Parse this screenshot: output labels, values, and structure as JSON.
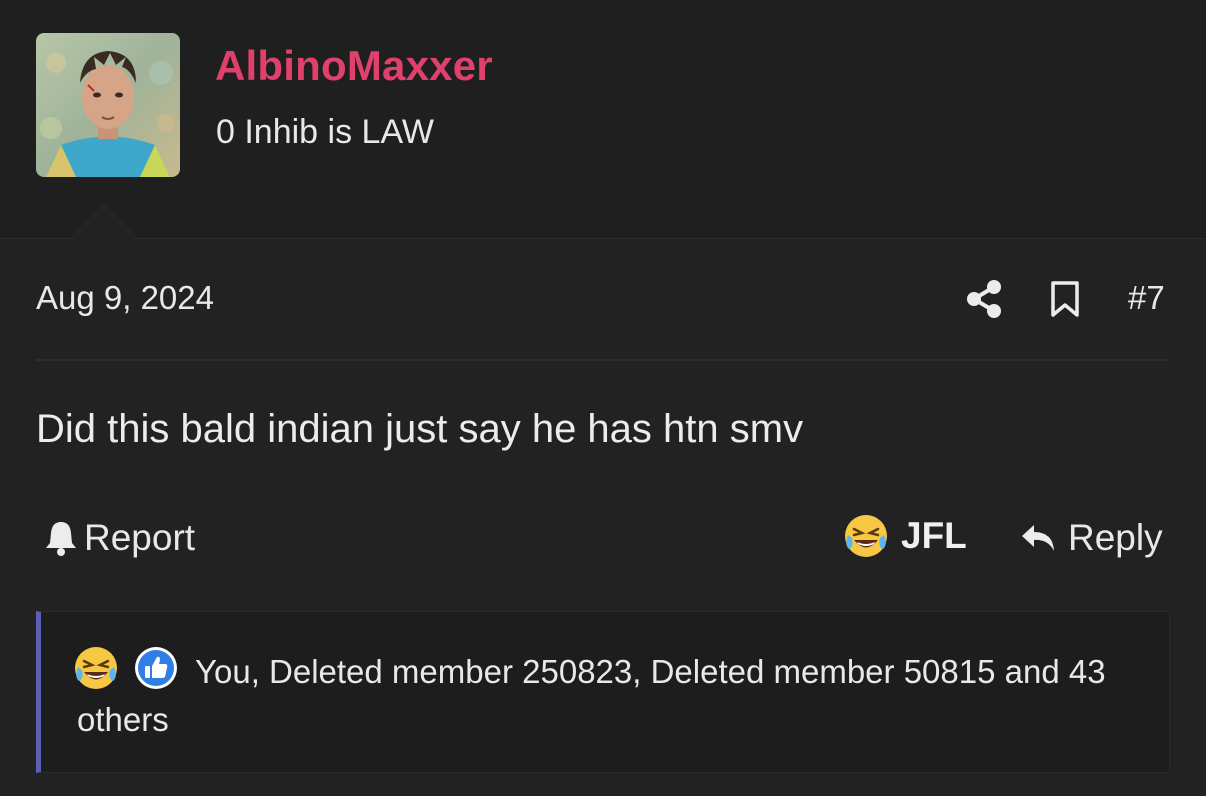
{
  "user": {
    "username": "AlbinoMaxxer",
    "title": "0 Inhib is LAW",
    "avatar_icon": "avatar-photo"
  },
  "post": {
    "date": "Aug 9, 2024",
    "number": "#7",
    "content": "Did this bald indian just say he has htn smv"
  },
  "actions": {
    "report_label": "Report",
    "reaction_label": "JFL",
    "reply_label": "Reply"
  },
  "reactions": {
    "summary": "You, Deleted member 250823, Deleted member 50815 and 43 others",
    "icons": [
      "crying-laughing-emoji",
      "thumbs-up-icon"
    ]
  },
  "colors": {
    "username": "#e0406c",
    "accent_bar": "#5a5fb8",
    "background": "#1f1f20"
  }
}
